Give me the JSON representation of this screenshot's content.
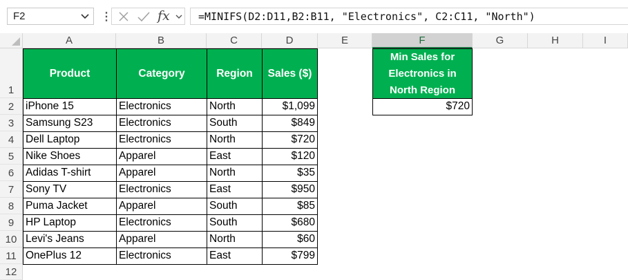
{
  "name_box": {
    "value": "F2"
  },
  "formula_bar": {
    "fx_label": "fx",
    "separator": "⋮",
    "formula": "=MINIFS(D2:D11,B2:B11, \"Electronics\", C2:C11, \"North\")"
  },
  "columns": [
    "A",
    "B",
    "C",
    "D",
    "E",
    "F",
    "G",
    "H",
    "I"
  ],
  "active_column": "F",
  "rows": [
    "1",
    "2",
    "3",
    "4",
    "5",
    "6",
    "7",
    "8",
    "9",
    "10",
    "11",
    "12"
  ],
  "table": {
    "headers": [
      "Product",
      "Category",
      "Region",
      "Sales ($)"
    ],
    "data": [
      [
        "iPhone 15",
        "Electronics",
        "North",
        "$1,099"
      ],
      [
        "Samsung S23",
        "Electronics",
        "South",
        "$849"
      ],
      [
        "Dell Laptop",
        "Electronics",
        "North",
        "$720"
      ],
      [
        "Nike Shoes",
        "Apparel",
        "East",
        "$120"
      ],
      [
        "Adidas T-shirt",
        "Apparel",
        "North",
        "$35"
      ],
      [
        "Sony TV",
        "Electronics",
        "East",
        "$950"
      ],
      [
        "Puma Jacket",
        "Apparel",
        "South",
        "$85"
      ],
      [
        "HP Laptop",
        "Electronics",
        "South",
        "$680"
      ],
      [
        "Levi's Jeans",
        "Apparel",
        "North",
        "$60"
      ],
      [
        "OnePlus 12",
        "Electronics",
        "East",
        "$799"
      ]
    ]
  },
  "result": {
    "header_lines": [
      "Min Sales for",
      "Electronics in",
      "North Region"
    ],
    "value": "$720"
  },
  "colors": {
    "header_fill": "#00B050",
    "header_text": "#FFFFFF",
    "active_col": "#217346"
  }
}
